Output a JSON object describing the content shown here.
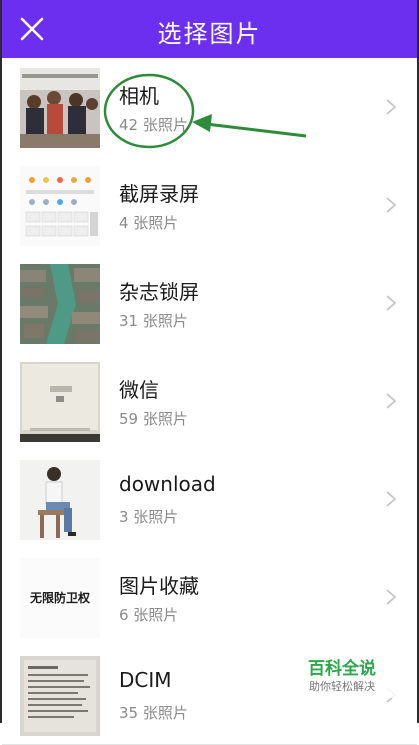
{
  "header": {
    "title": "选择图片",
    "close_icon": "close-icon",
    "background": "#6c2ff0"
  },
  "albums": [
    {
      "name": "相机",
      "count": "42 张照片",
      "thumb": "classroom-photo"
    },
    {
      "name": "截屏录屏",
      "count": "4 张照片",
      "thumb": "screenshot-keypad"
    },
    {
      "name": "杂志锁屏",
      "count": "31 张照片",
      "thumb": "aerial-water-town"
    },
    {
      "name": "微信",
      "count": "59 张照片",
      "thumb": "screen-photo"
    },
    {
      "name": "download",
      "count": "3 张照片",
      "thumb": "person-on-stool"
    },
    {
      "name": "图片收藏",
      "count": "6 张照片",
      "thumb": "calligraphy-text",
      "thumb_text": "无限防卫权"
    },
    {
      "name": "DCIM",
      "count": "35 张照片",
      "thumb": "document-scan"
    }
  ],
  "annotation": {
    "color": "#2e8b3a"
  },
  "watermark": {
    "main": "百科全说",
    "sub": "助你轻松解决"
  }
}
